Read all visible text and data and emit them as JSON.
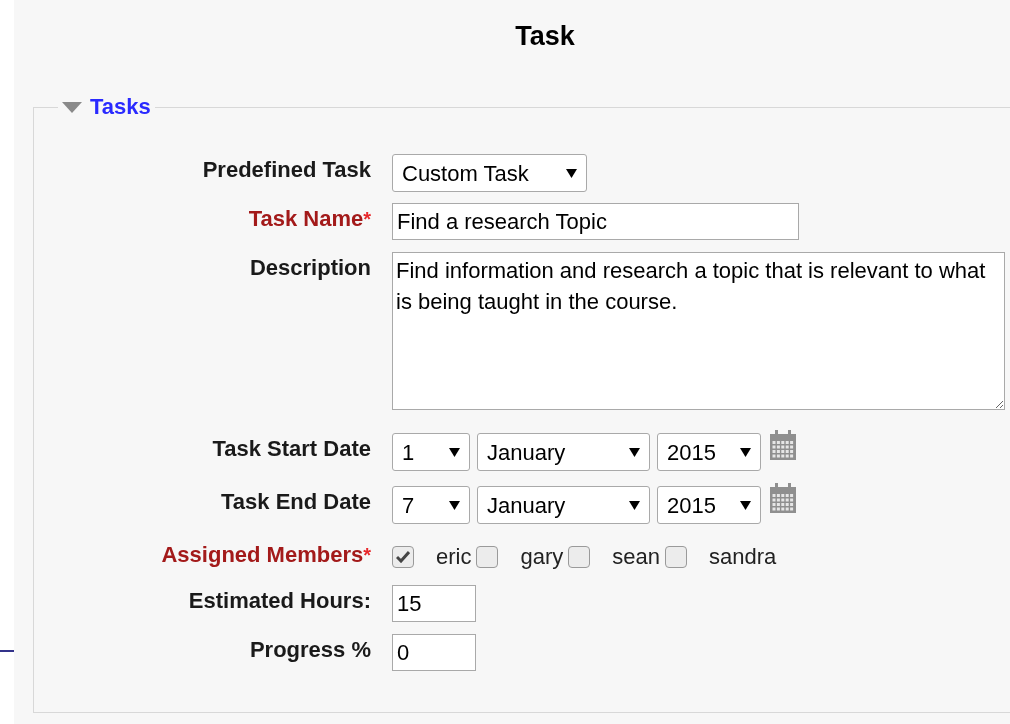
{
  "page": {
    "title": "Task"
  },
  "section": {
    "title": "Tasks",
    "expanded": true
  },
  "fields": [
    {
      "kind": "select",
      "label": "Predefined Task",
      "required": false,
      "value": "Custom Task"
    },
    {
      "kind": "text",
      "label": "Task Name",
      "required": true,
      "marker": "*",
      "value": "Find a research Topic"
    },
    {
      "kind": "textarea",
      "label": "Description",
      "required": false,
      "value": "Find information and research a topic that is relevant to what is being taught in the course."
    },
    {
      "kind": "date",
      "label": "Task Start Date",
      "required": false,
      "day": "1",
      "month": "January",
      "year": "2015"
    },
    {
      "kind": "date",
      "label": "Task End Date",
      "required": false,
      "day": "7",
      "month": "January",
      "year": "2015"
    },
    {
      "kind": "checkboxes",
      "label": "Assigned Members",
      "required": true,
      "marker": "*",
      "options": [
        {
          "label": "eric",
          "checked": true
        },
        {
          "label": "gary",
          "checked": false
        },
        {
          "label": "sean",
          "checked": false
        },
        {
          "label": "sandra",
          "checked": false
        }
      ]
    },
    {
      "kind": "number",
      "label": "Estimated Hours:",
      "required": false,
      "value": "15"
    },
    {
      "kind": "number",
      "label": "Progress %",
      "required": false,
      "value": "0"
    }
  ]
}
